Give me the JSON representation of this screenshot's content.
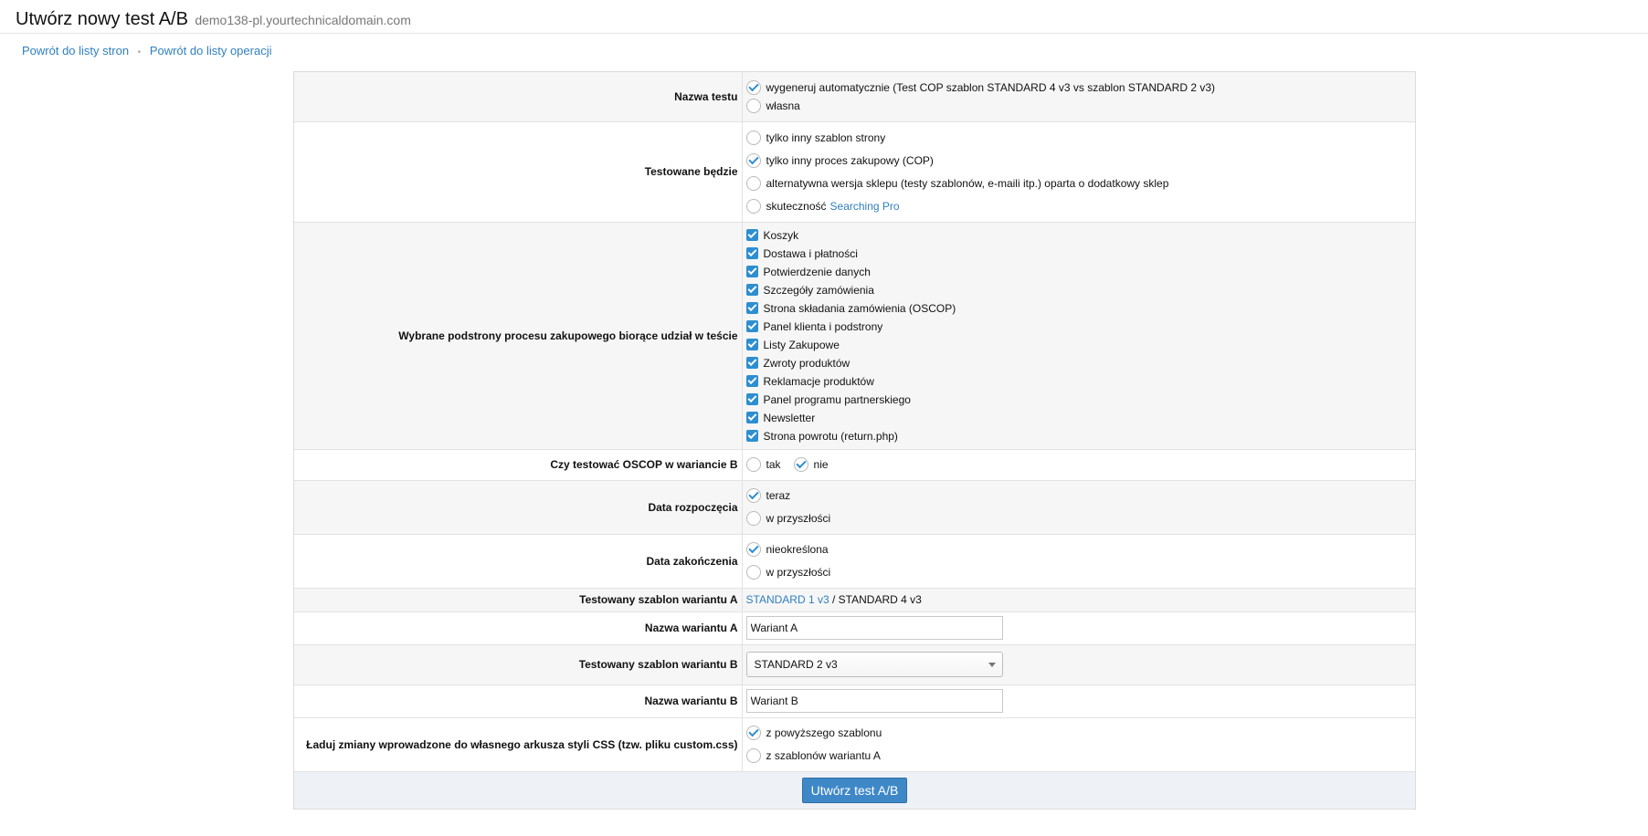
{
  "header": {
    "title": "Utwórz nowy test A/B",
    "domain": "demo138-pl.yourtechnicaldomain.com"
  },
  "breadcrumbs": {
    "link1": "Powrót do listy stron",
    "separator": "•",
    "link2": "Powrót do listy operacji"
  },
  "form": {
    "test_name": {
      "label": "Nazwa testu",
      "options": [
        {
          "label": "wygeneruj automatycznie (Test COP szablon STANDARD 4 v3 vs szablon STANDARD 2 v3)",
          "selected": true
        },
        {
          "label": "własna",
          "selected": false
        }
      ]
    },
    "tested": {
      "label": "Testowane będzie",
      "options": [
        {
          "label": "tylko inny szablon strony",
          "selected": false
        },
        {
          "label": "tylko inny proces zakupowy (COP)",
          "selected": true
        },
        {
          "label": "alternatywna wersja sklepu (testy szablonów, e-maili itp.) oparta o dodatkowy sklep",
          "selected": false
        },
        {
          "label": "skuteczność",
          "link": "Searching Pro",
          "selected": false
        }
      ]
    },
    "subpages": {
      "label": "Wybrane podstrony procesu zakupowego biorące udział w teście",
      "items": [
        {
          "label": "Koszyk",
          "checked": true
        },
        {
          "label": "Dostawa i płatności",
          "checked": true
        },
        {
          "label": "Potwierdzenie danych",
          "checked": true
        },
        {
          "label": "Szczegóły zamówienia",
          "checked": true
        },
        {
          "label": "Strona składania zamówienia (OSCOP)",
          "checked": true
        },
        {
          "label": "Panel klienta i podstrony",
          "checked": true
        },
        {
          "label": "Listy Zakupowe",
          "checked": true
        },
        {
          "label": "Zwroty produktów",
          "checked": true
        },
        {
          "label": "Reklamacje produktów",
          "checked": true
        },
        {
          "label": "Panel programu partnerskiego",
          "checked": true
        },
        {
          "label": "Newsletter",
          "checked": true
        },
        {
          "label": "Strona powrotu (return.php)",
          "checked": true
        }
      ]
    },
    "oscop": {
      "label": "Czy testować OSCOP w wariancie B",
      "options": [
        {
          "label": "tak",
          "selected": false
        },
        {
          "label": "nie",
          "selected": true
        }
      ]
    },
    "start_date": {
      "label": "Data rozpoczęcia",
      "options": [
        {
          "label": "teraz",
          "selected": true
        },
        {
          "label": "w przyszłości",
          "selected": false
        }
      ]
    },
    "end_date": {
      "label": "Data zakończenia",
      "options": [
        {
          "label": "nieokreślona",
          "selected": true
        },
        {
          "label": "w przyszłości",
          "selected": false
        }
      ]
    },
    "template_a": {
      "label": "Testowany szablon wariantu A",
      "link": "STANDARD 1 v3",
      "separator": "/",
      "current": "STANDARD 4 v3"
    },
    "name_a": {
      "label": "Nazwa wariantu A",
      "value": "Wariant A"
    },
    "template_b": {
      "label": "Testowany szablon wariantu B",
      "selected": "STANDARD 2 v3"
    },
    "name_b": {
      "label": "Nazwa wariantu B",
      "value": "Wariant B"
    },
    "css": {
      "label": "Ładuj zmiany wprowadzone do własnego arkusza styli CSS (tzw. pliku custom.css)",
      "options": [
        {
          "label": "z powyższego szablonu",
          "selected": true
        },
        {
          "label": "z szablonów wariantu A",
          "selected": false
        }
      ]
    },
    "submit_label": "Utwórz test A/B"
  },
  "colors": {
    "accent": "#2d8ed0",
    "link": "#2f7fc0",
    "button": "#3f88c8"
  }
}
